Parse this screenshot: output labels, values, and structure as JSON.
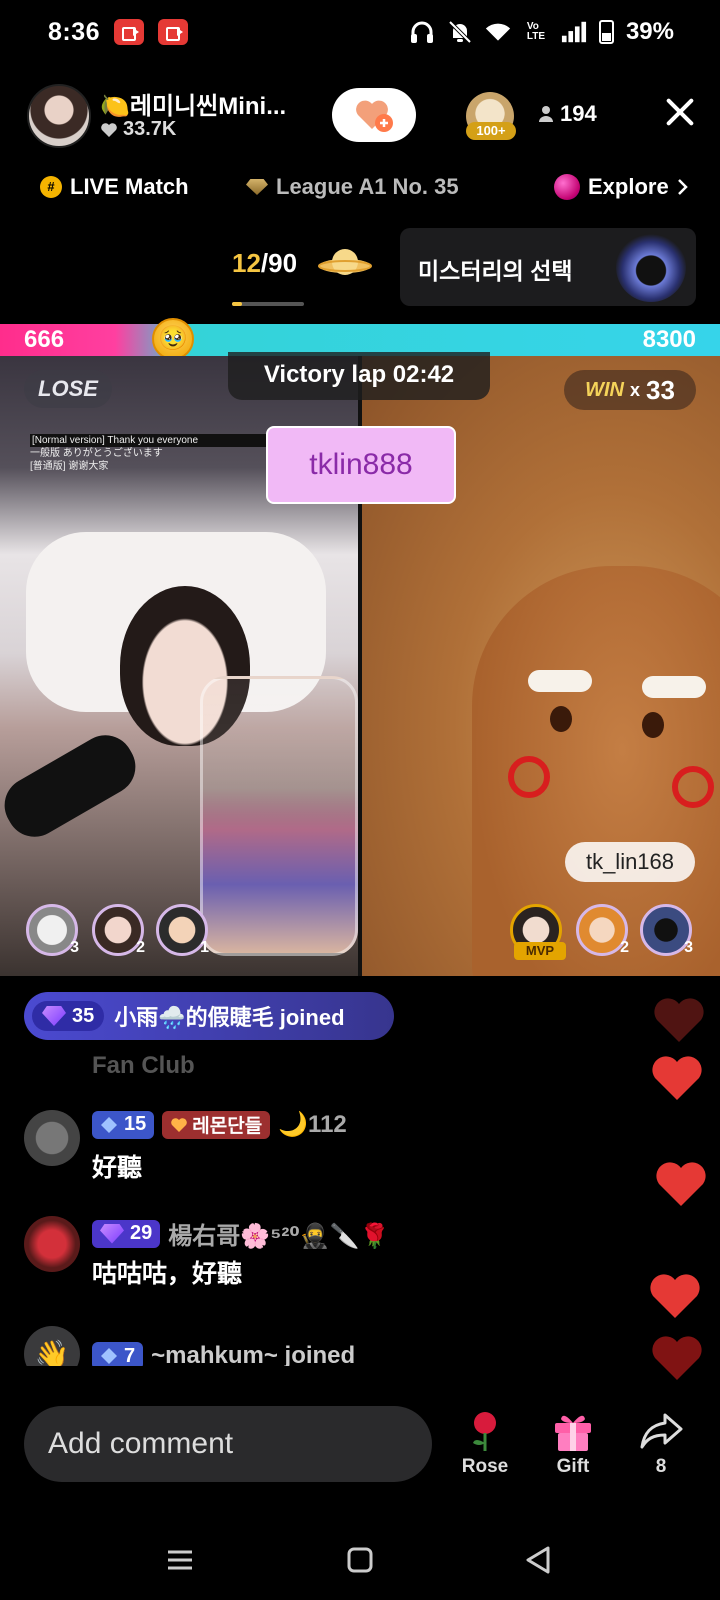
{
  "status_bar": {
    "time": "8:36",
    "battery": "39%",
    "icons": [
      "screen-record-icon",
      "screen-record-icon",
      "headphones-icon",
      "mute-icon",
      "wifi-icon",
      "volte-icon",
      "signal-icon",
      "battery-icon"
    ]
  },
  "header": {
    "host_name": "🍋레미니씬Mini...",
    "likes": "33.7K",
    "viewer_badge": "100+",
    "viewer_count": "194"
  },
  "info_row": {
    "live_match": "LIVE Match",
    "league": "League A1 No. 35",
    "explore": "Explore"
  },
  "match": {
    "current": "12",
    "total": "/90",
    "mystery_label": "미스터리의 선택"
  },
  "battle": {
    "score_left": "666",
    "score_right": "8300",
    "result_left": "LOSE",
    "victory_lap": "Victory lap  02:42",
    "win_label": "WIN",
    "win_x": "x",
    "win_count": "33",
    "caption_line1": "[Normal version] Thank you everyone",
    "caption_line2": "一般版 ありがとうございます",
    "caption_line3": "[普通版] 谢谢大家",
    "user_tag": "tklin888",
    "right_name": "tk_lin168",
    "left_fans": [
      "3",
      "2",
      "1"
    ],
    "right_fans": [
      "",
      "2",
      "3"
    ],
    "mvp": "MVP"
  },
  "chat": {
    "join_banner": {
      "level": "35",
      "text": "小雨🌧️的假睫毛 joined"
    },
    "fan_club_fade": "Fan Club",
    "messages": [
      {
        "level": "15",
        "fan_badge": "레몬단들",
        "name": "🌙112",
        "text": "好聽"
      },
      {
        "level": "29",
        "fan_badge": "",
        "name": "楊右哥🌸⁵²⁰🥷🔪🌹",
        "text": "咕咕咕，好聽"
      },
      {
        "level": "7",
        "fan_badge": "",
        "name": "~mahkum~ joined",
        "text": ""
      }
    ]
  },
  "bottom_bar": {
    "comment_placeholder": "Add comment",
    "rose_label": "Rose",
    "gift_label": "Gift",
    "share_count": "8"
  }
}
